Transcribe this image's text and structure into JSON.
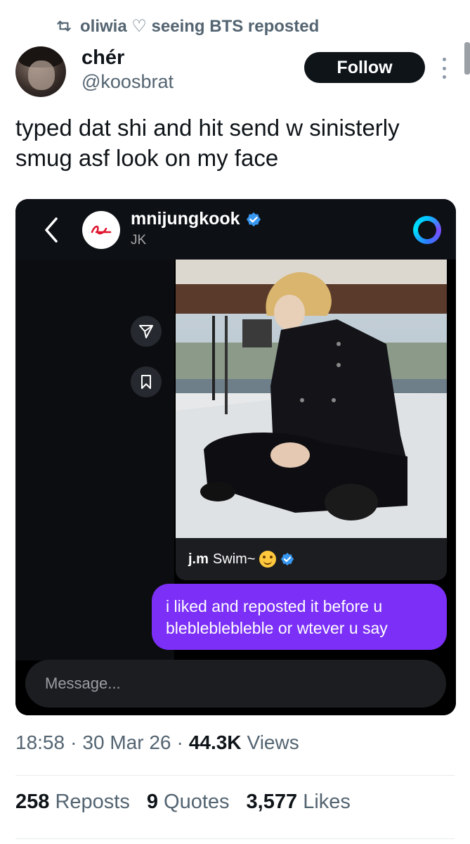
{
  "repost": {
    "text": "oliwia ♡ seeing BTS reposted",
    "icon": "repost-icon"
  },
  "author": {
    "name": "chér",
    "handle": "@koosbrat"
  },
  "follow_label": "Follow",
  "tweet_text": "typed dat shi and hit send w sinisterly smug asf look on my face",
  "dm": {
    "username": "mnijungkook",
    "subtitle": "JK",
    "caption_user": "j.m",
    "caption_text": "Swim~",
    "message_text": "i liked and reposted it before u blebleblebleble or wtever u say",
    "input_placeholder": "Message..."
  },
  "meta": {
    "time": "18:58",
    "date": "30 Mar 26",
    "views_count": "44.3K",
    "views_label": "Views",
    "dot": "·"
  },
  "stats": {
    "reposts_count": "258",
    "reposts_label": "Reposts",
    "quotes_count": "9",
    "quotes_label": "Quotes",
    "likes_count": "3,577",
    "likes_label": "Likes"
  },
  "colors": {
    "accent_purple": "#7b2ff7",
    "verified_blue": "#3897f0",
    "text_dark": "#0f1419",
    "text_muted": "#536471"
  }
}
